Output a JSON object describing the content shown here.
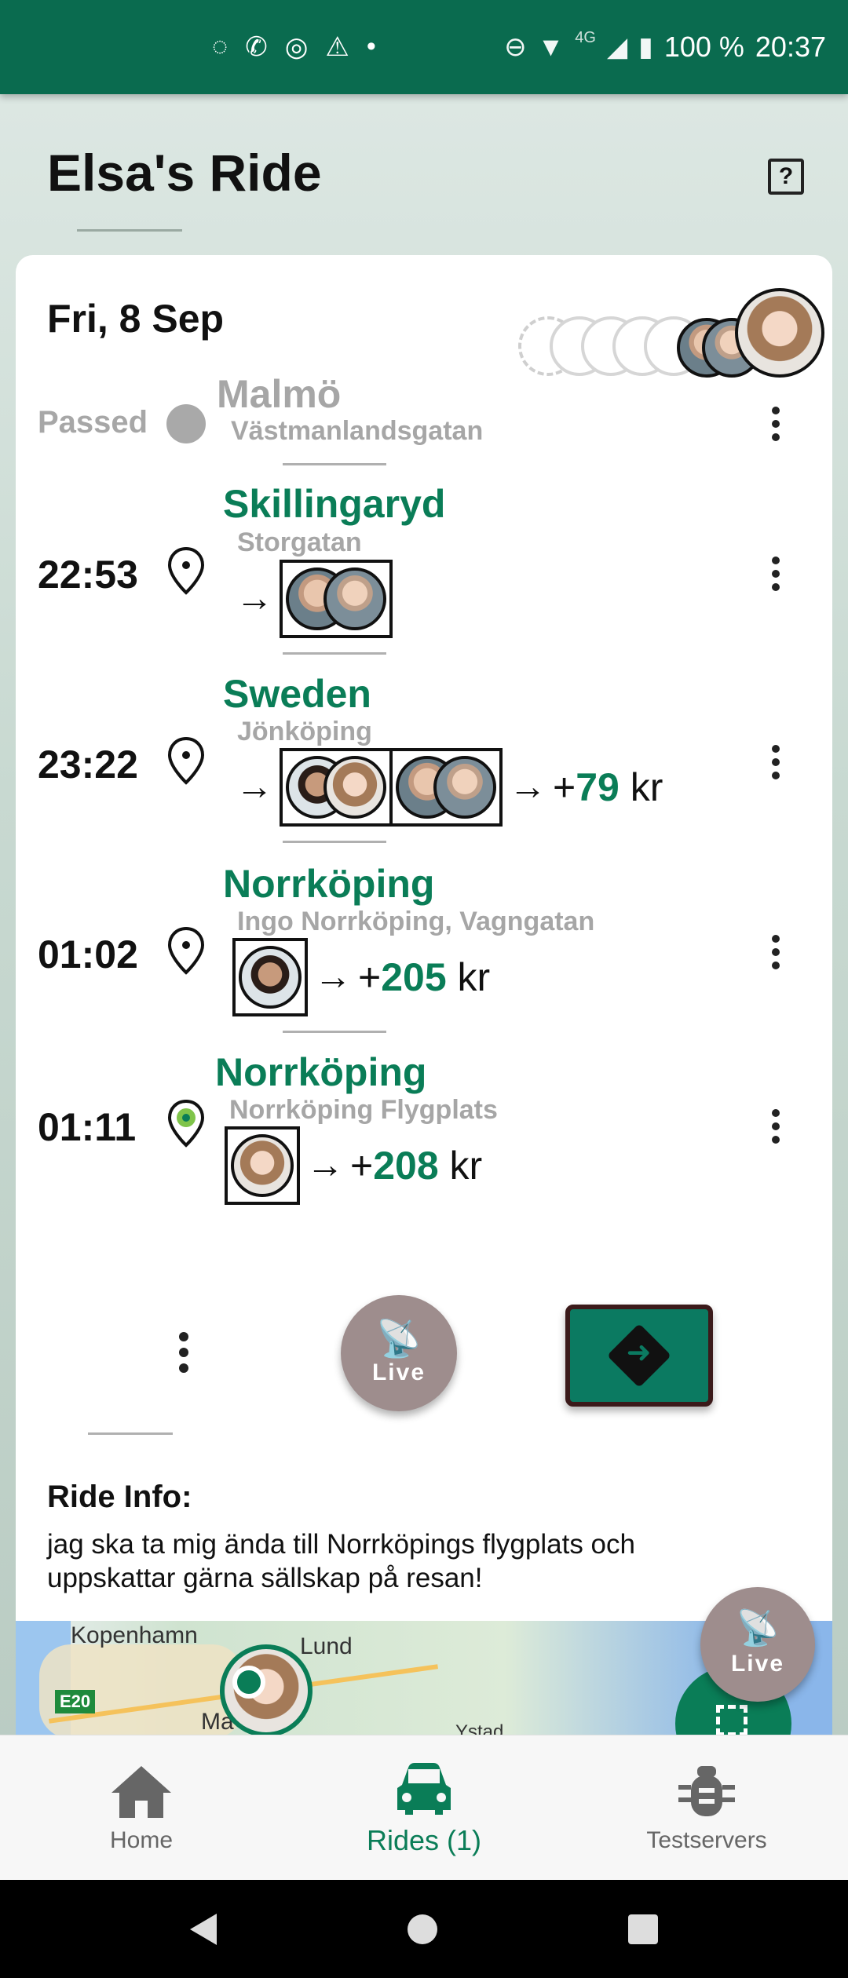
{
  "status_bar": {
    "battery": "100 %",
    "time": "20:37",
    "network": "4G"
  },
  "header": {
    "title": "Elsa's Ride",
    "help_icon": "?"
  },
  "ride": {
    "date": "Fri, 8 Sep"
  },
  "stops": [
    {
      "label": "Passed",
      "city": "Malmö",
      "street": "Västmanlandsgatan"
    },
    {
      "time": "22:53",
      "city": "Skillingaryd",
      "street": "Storgatan"
    },
    {
      "time": "23:22",
      "city": "Sweden",
      "street": "Jönköping",
      "price_prefix": "+",
      "price_value": "79",
      "price_unit": " kr"
    },
    {
      "time": "01:02",
      "city": "Norrköping",
      "street": "Ingo Norrköping, Vagngatan",
      "price_prefix": "+",
      "price_value": "205",
      "price_unit": " kr"
    },
    {
      "time": "01:11",
      "city": "Norrköping",
      "street": "Norrköping Flygplats",
      "price_prefix": "+",
      "price_value": "208",
      "price_unit": " kr"
    }
  ],
  "actions": {
    "live_label": "Live"
  },
  "ride_info": {
    "heading": "Ride Info:",
    "text": "jag ska ta mig ända till Norrköpings flygplats och uppskattar gärna sällskap på resan!"
  },
  "map": {
    "labels": {
      "copenhagen": "Kopenhamn",
      "lund": "Lund",
      "road": "E20",
      "ma": "Ma",
      "ystad": "Ystad"
    },
    "live_label": "Live"
  },
  "bottom_nav": [
    {
      "label": "Home"
    },
    {
      "label": "Rides (1)"
    },
    {
      "label": "Testservers"
    }
  ],
  "colors": {
    "brand_green": "#0a7d57",
    "status_bar": "#0a6b4f",
    "live_button": "#9e8d8d"
  }
}
